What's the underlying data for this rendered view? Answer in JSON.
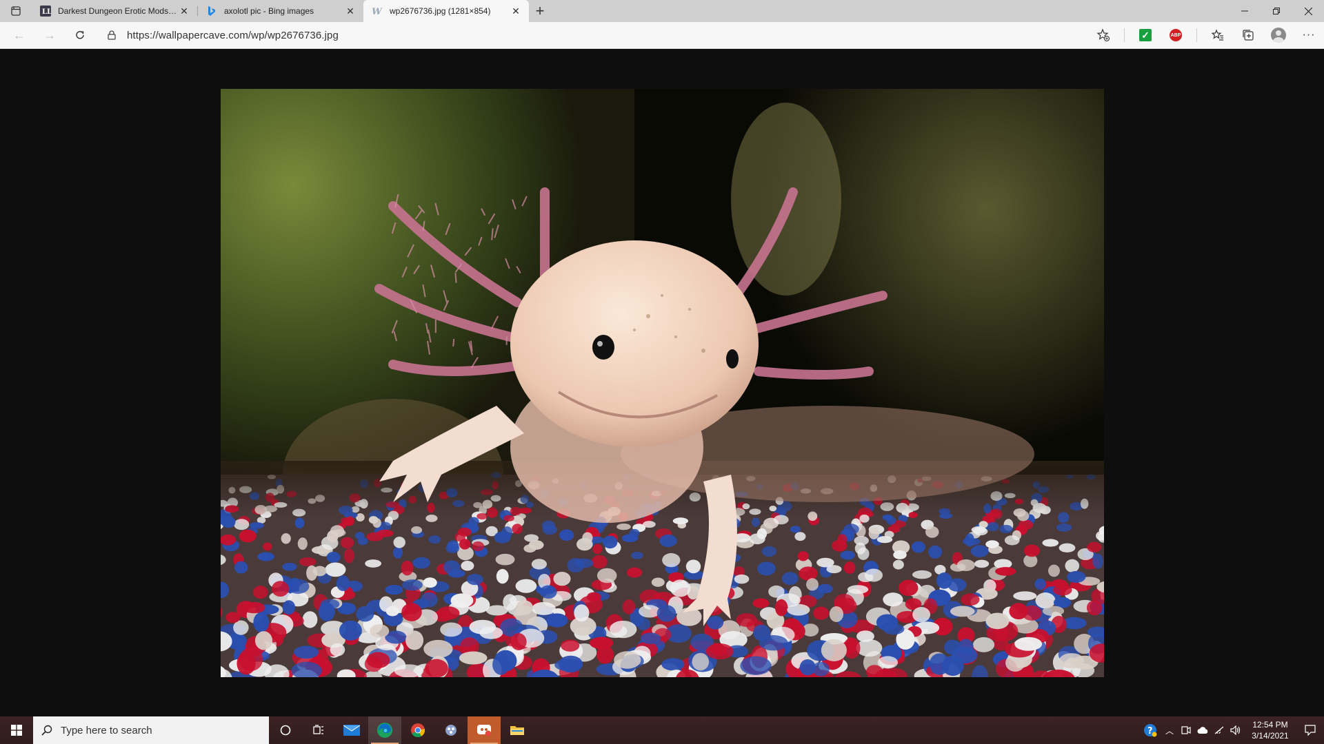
{
  "browser": {
    "tabs": [
      {
        "title": "Darkest Dungeon Erotic Mods - F",
        "favicon": "ll-site-icon",
        "active": false
      },
      {
        "title": "axolotl pic - Bing images",
        "favicon": "bing-icon",
        "active": false
      },
      {
        "title": "wp2676736.jpg (1281×854)",
        "favicon": "wallpapercave-icon",
        "active": true
      }
    ],
    "address": {
      "url": "https://wallpapercave.com/wp/wp2676736.jpg"
    },
    "extensions": {
      "check_label": "✓",
      "abp_label": "ABP"
    }
  },
  "image": {
    "description_icon": "axolotl-photo",
    "colors": {
      "skin": "#f0d6c4",
      "gills": "#c77390",
      "gravel_red": "#c8102e",
      "gravel_blue": "#2a4fb0",
      "gravel_white": "#eeeeee"
    }
  },
  "taskbar": {
    "search_placeholder": "Type here to search",
    "time": "12:54 PM",
    "date": "3/14/2021"
  }
}
